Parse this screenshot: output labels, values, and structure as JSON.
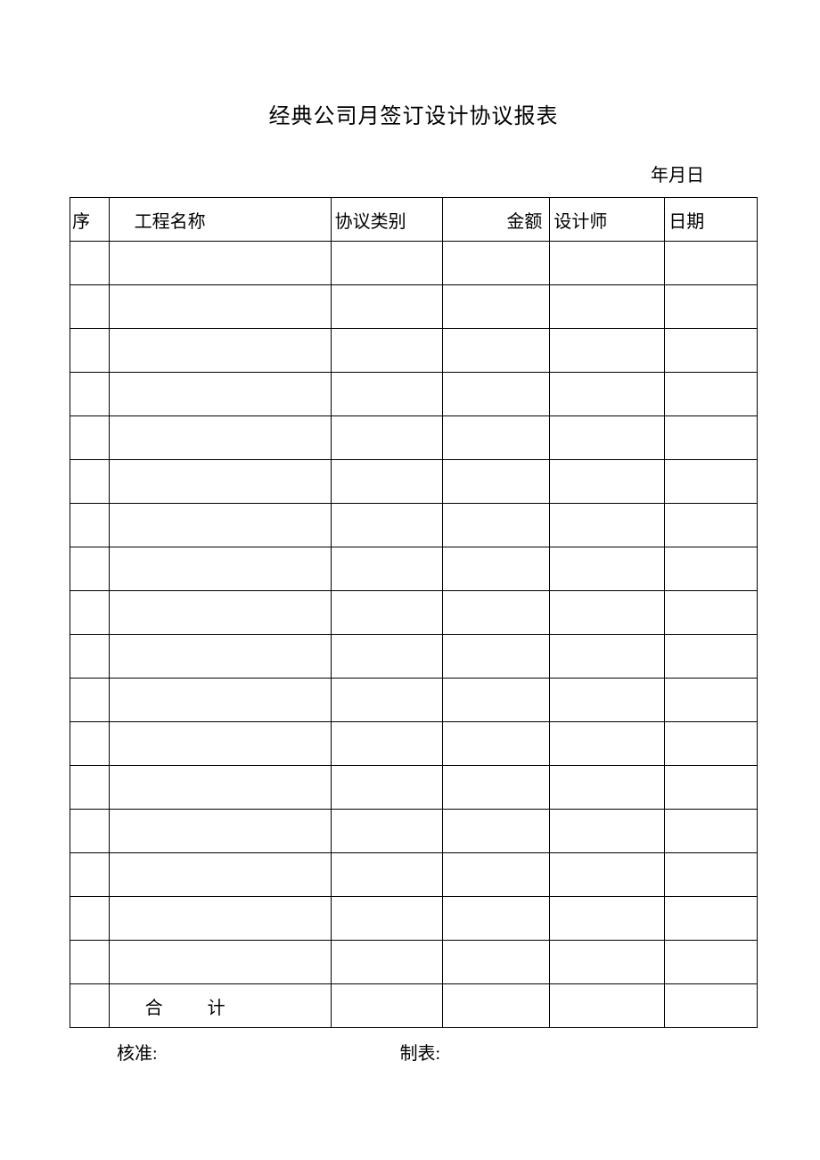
{
  "title": "经典公司月签订设计协议报表",
  "dateLine": "年月日",
  "headers": {
    "seq": "序",
    "projectName": "工程名称",
    "agreementType": "协议类别",
    "amount": "金额",
    "designer": "设计师",
    "date": "日期"
  },
  "rows": [
    {
      "seq": "",
      "projectName": "",
      "agreementType": "",
      "amount": "",
      "designer": "",
      "date": ""
    },
    {
      "seq": "",
      "projectName": "",
      "agreementType": "",
      "amount": "",
      "designer": "",
      "date": ""
    },
    {
      "seq": "",
      "projectName": "",
      "agreementType": "",
      "amount": "",
      "designer": "",
      "date": ""
    },
    {
      "seq": "",
      "projectName": "",
      "agreementType": "",
      "amount": "",
      "designer": "",
      "date": ""
    },
    {
      "seq": "",
      "projectName": "",
      "agreementType": "",
      "amount": "",
      "designer": "",
      "date": ""
    },
    {
      "seq": "",
      "projectName": "",
      "agreementType": "",
      "amount": "",
      "designer": "",
      "date": ""
    },
    {
      "seq": "",
      "projectName": "",
      "agreementType": "",
      "amount": "",
      "designer": "",
      "date": ""
    },
    {
      "seq": "",
      "projectName": "",
      "agreementType": "",
      "amount": "",
      "designer": "",
      "date": ""
    },
    {
      "seq": "",
      "projectName": "",
      "agreementType": "",
      "amount": "",
      "designer": "",
      "date": ""
    },
    {
      "seq": "",
      "projectName": "",
      "agreementType": "",
      "amount": "",
      "designer": "",
      "date": ""
    },
    {
      "seq": "",
      "projectName": "",
      "agreementType": "",
      "amount": "",
      "designer": "",
      "date": ""
    },
    {
      "seq": "",
      "projectName": "",
      "agreementType": "",
      "amount": "",
      "designer": "",
      "date": ""
    },
    {
      "seq": "",
      "projectName": "",
      "agreementType": "",
      "amount": "",
      "designer": "",
      "date": ""
    },
    {
      "seq": "",
      "projectName": "",
      "agreementType": "",
      "amount": "",
      "designer": "",
      "date": ""
    },
    {
      "seq": "",
      "projectName": "",
      "agreementType": "",
      "amount": "",
      "designer": "",
      "date": ""
    },
    {
      "seq": "",
      "projectName": "",
      "agreementType": "",
      "amount": "",
      "designer": "",
      "date": ""
    },
    {
      "seq": "",
      "projectName": "",
      "agreementType": "",
      "amount": "",
      "designer": "",
      "date": ""
    }
  ],
  "totalRow": {
    "label": "合计",
    "agreementType": "",
    "amount": "",
    "designer": "",
    "date": ""
  },
  "footer": {
    "approver": "核准:",
    "preparer": "制表:"
  }
}
